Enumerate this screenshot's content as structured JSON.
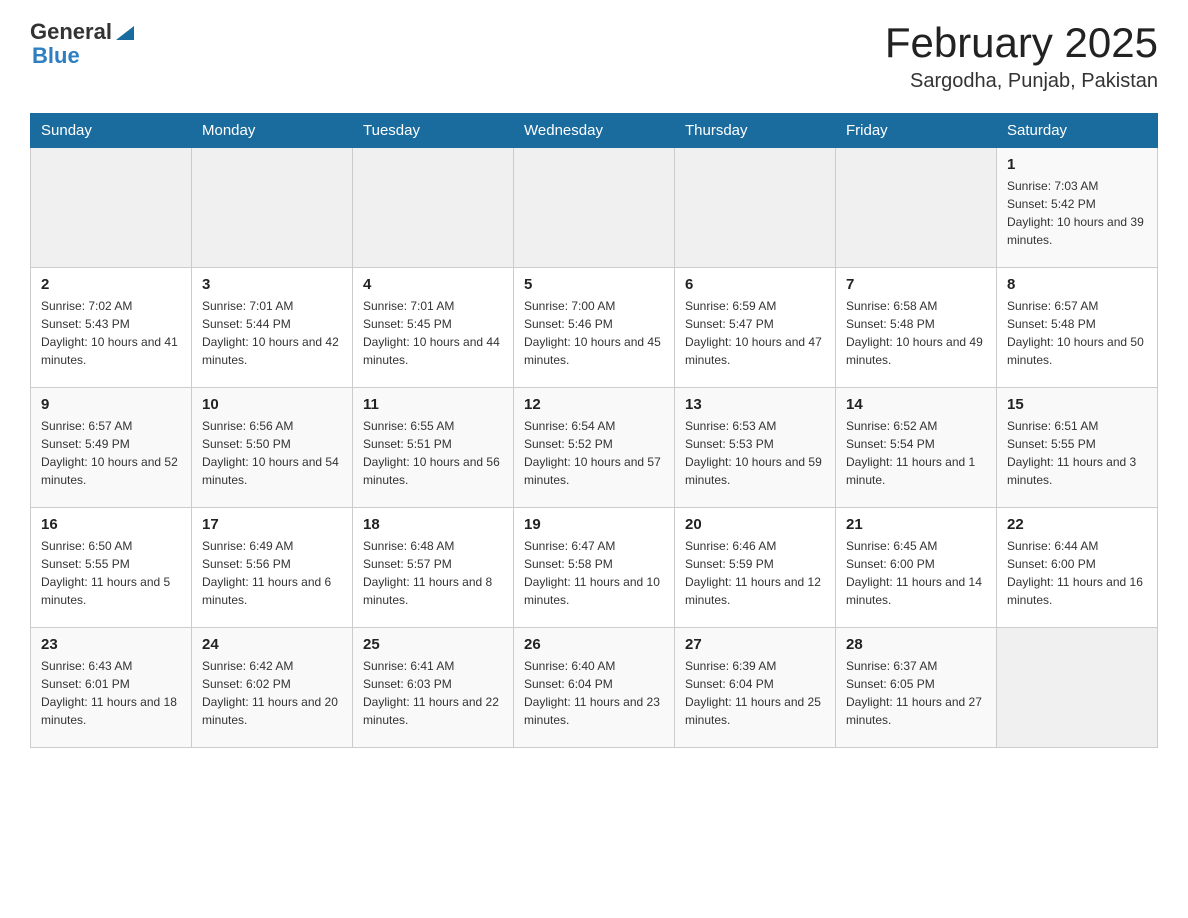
{
  "header": {
    "logo_general": "General",
    "logo_blue": "Blue",
    "month": "February 2025",
    "location": "Sargodha, Punjab, Pakistan"
  },
  "days_of_week": [
    "Sunday",
    "Monday",
    "Tuesday",
    "Wednesday",
    "Thursday",
    "Friday",
    "Saturday"
  ],
  "weeks": [
    [
      {
        "day": "",
        "info": ""
      },
      {
        "day": "",
        "info": ""
      },
      {
        "day": "",
        "info": ""
      },
      {
        "day": "",
        "info": ""
      },
      {
        "day": "",
        "info": ""
      },
      {
        "day": "",
        "info": ""
      },
      {
        "day": "1",
        "info": "Sunrise: 7:03 AM\nSunset: 5:42 PM\nDaylight: 10 hours and 39 minutes."
      }
    ],
    [
      {
        "day": "2",
        "info": "Sunrise: 7:02 AM\nSunset: 5:43 PM\nDaylight: 10 hours and 41 minutes."
      },
      {
        "day": "3",
        "info": "Sunrise: 7:01 AM\nSunset: 5:44 PM\nDaylight: 10 hours and 42 minutes."
      },
      {
        "day": "4",
        "info": "Sunrise: 7:01 AM\nSunset: 5:45 PM\nDaylight: 10 hours and 44 minutes."
      },
      {
        "day": "5",
        "info": "Sunrise: 7:00 AM\nSunset: 5:46 PM\nDaylight: 10 hours and 45 minutes."
      },
      {
        "day": "6",
        "info": "Sunrise: 6:59 AM\nSunset: 5:47 PM\nDaylight: 10 hours and 47 minutes."
      },
      {
        "day": "7",
        "info": "Sunrise: 6:58 AM\nSunset: 5:48 PM\nDaylight: 10 hours and 49 minutes."
      },
      {
        "day": "8",
        "info": "Sunrise: 6:57 AM\nSunset: 5:48 PM\nDaylight: 10 hours and 50 minutes."
      }
    ],
    [
      {
        "day": "9",
        "info": "Sunrise: 6:57 AM\nSunset: 5:49 PM\nDaylight: 10 hours and 52 minutes."
      },
      {
        "day": "10",
        "info": "Sunrise: 6:56 AM\nSunset: 5:50 PM\nDaylight: 10 hours and 54 minutes."
      },
      {
        "day": "11",
        "info": "Sunrise: 6:55 AM\nSunset: 5:51 PM\nDaylight: 10 hours and 56 minutes."
      },
      {
        "day": "12",
        "info": "Sunrise: 6:54 AM\nSunset: 5:52 PM\nDaylight: 10 hours and 57 minutes."
      },
      {
        "day": "13",
        "info": "Sunrise: 6:53 AM\nSunset: 5:53 PM\nDaylight: 10 hours and 59 minutes."
      },
      {
        "day": "14",
        "info": "Sunrise: 6:52 AM\nSunset: 5:54 PM\nDaylight: 11 hours and 1 minute."
      },
      {
        "day": "15",
        "info": "Sunrise: 6:51 AM\nSunset: 5:55 PM\nDaylight: 11 hours and 3 minutes."
      }
    ],
    [
      {
        "day": "16",
        "info": "Sunrise: 6:50 AM\nSunset: 5:55 PM\nDaylight: 11 hours and 5 minutes."
      },
      {
        "day": "17",
        "info": "Sunrise: 6:49 AM\nSunset: 5:56 PM\nDaylight: 11 hours and 6 minutes."
      },
      {
        "day": "18",
        "info": "Sunrise: 6:48 AM\nSunset: 5:57 PM\nDaylight: 11 hours and 8 minutes."
      },
      {
        "day": "19",
        "info": "Sunrise: 6:47 AM\nSunset: 5:58 PM\nDaylight: 11 hours and 10 minutes."
      },
      {
        "day": "20",
        "info": "Sunrise: 6:46 AM\nSunset: 5:59 PM\nDaylight: 11 hours and 12 minutes."
      },
      {
        "day": "21",
        "info": "Sunrise: 6:45 AM\nSunset: 6:00 PM\nDaylight: 11 hours and 14 minutes."
      },
      {
        "day": "22",
        "info": "Sunrise: 6:44 AM\nSunset: 6:00 PM\nDaylight: 11 hours and 16 minutes."
      }
    ],
    [
      {
        "day": "23",
        "info": "Sunrise: 6:43 AM\nSunset: 6:01 PM\nDaylight: 11 hours and 18 minutes."
      },
      {
        "day": "24",
        "info": "Sunrise: 6:42 AM\nSunset: 6:02 PM\nDaylight: 11 hours and 20 minutes."
      },
      {
        "day": "25",
        "info": "Sunrise: 6:41 AM\nSunset: 6:03 PM\nDaylight: 11 hours and 22 minutes."
      },
      {
        "day": "26",
        "info": "Sunrise: 6:40 AM\nSunset: 6:04 PM\nDaylight: 11 hours and 23 minutes."
      },
      {
        "day": "27",
        "info": "Sunrise: 6:39 AM\nSunset: 6:04 PM\nDaylight: 11 hours and 25 minutes."
      },
      {
        "day": "28",
        "info": "Sunrise: 6:37 AM\nSunset: 6:05 PM\nDaylight: 11 hours and 27 minutes."
      },
      {
        "day": "",
        "info": ""
      }
    ]
  ]
}
